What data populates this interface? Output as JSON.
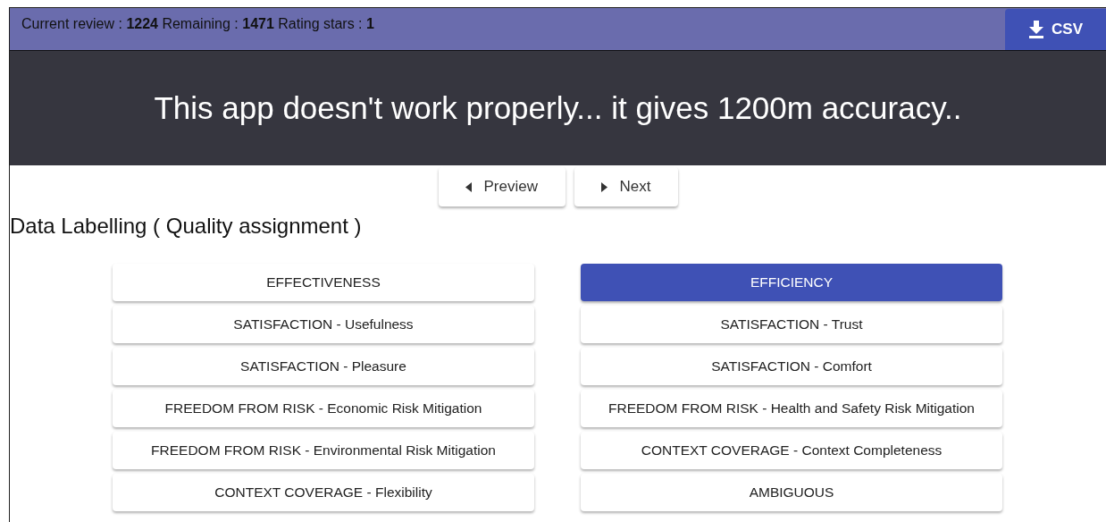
{
  "header": {
    "stats": "Current review : **1224** Remaining : **1471** Rating stars : **1**",
    "export_button": "CSV"
  },
  "review_text": "This app doesn't work properly... it gives 1200m accuracy..",
  "navigation": [
    {
      "label": "Preview",
      "kind": "previous"
    },
    {
      "label": "Next",
      "kind": "next"
    }
  ],
  "section_title": "Data Labelling ( Quality assignment )",
  "labels": [
    {
      "label": "EFFECTIVENESS",
      "selected": false
    },
    {
      "label": "EFFICIENCY",
      "selected": true
    },
    {
      "label": "SATISFACTION - Usefulness",
      "selected": false
    },
    {
      "label": "SATISFACTION - Trust",
      "selected": false
    },
    {
      "label": "SATISFACTION - Pleasure",
      "selected": false
    },
    {
      "label": "SATISFACTION - Comfort",
      "selected": false
    },
    {
      "label": "FREEDOM FROM RISK - Economic Risk Mitigation",
      "selected": false
    },
    {
      "label": "FREEDOM FROM RISK - Health and Safety Risk Mitigation",
      "selected": false
    },
    {
      "label": "FREEDOM FROM RISK - Environmental Risk Mitigation",
      "selected": false
    },
    {
      "label": "CONTEXT COVERAGE - Context Completeness",
      "selected": false
    },
    {
      "label": "CONTEXT COVERAGE - Flexibility",
      "selected": false
    },
    {
      "label": "AMBIGUOUS",
      "selected": false
    }
  ]
}
